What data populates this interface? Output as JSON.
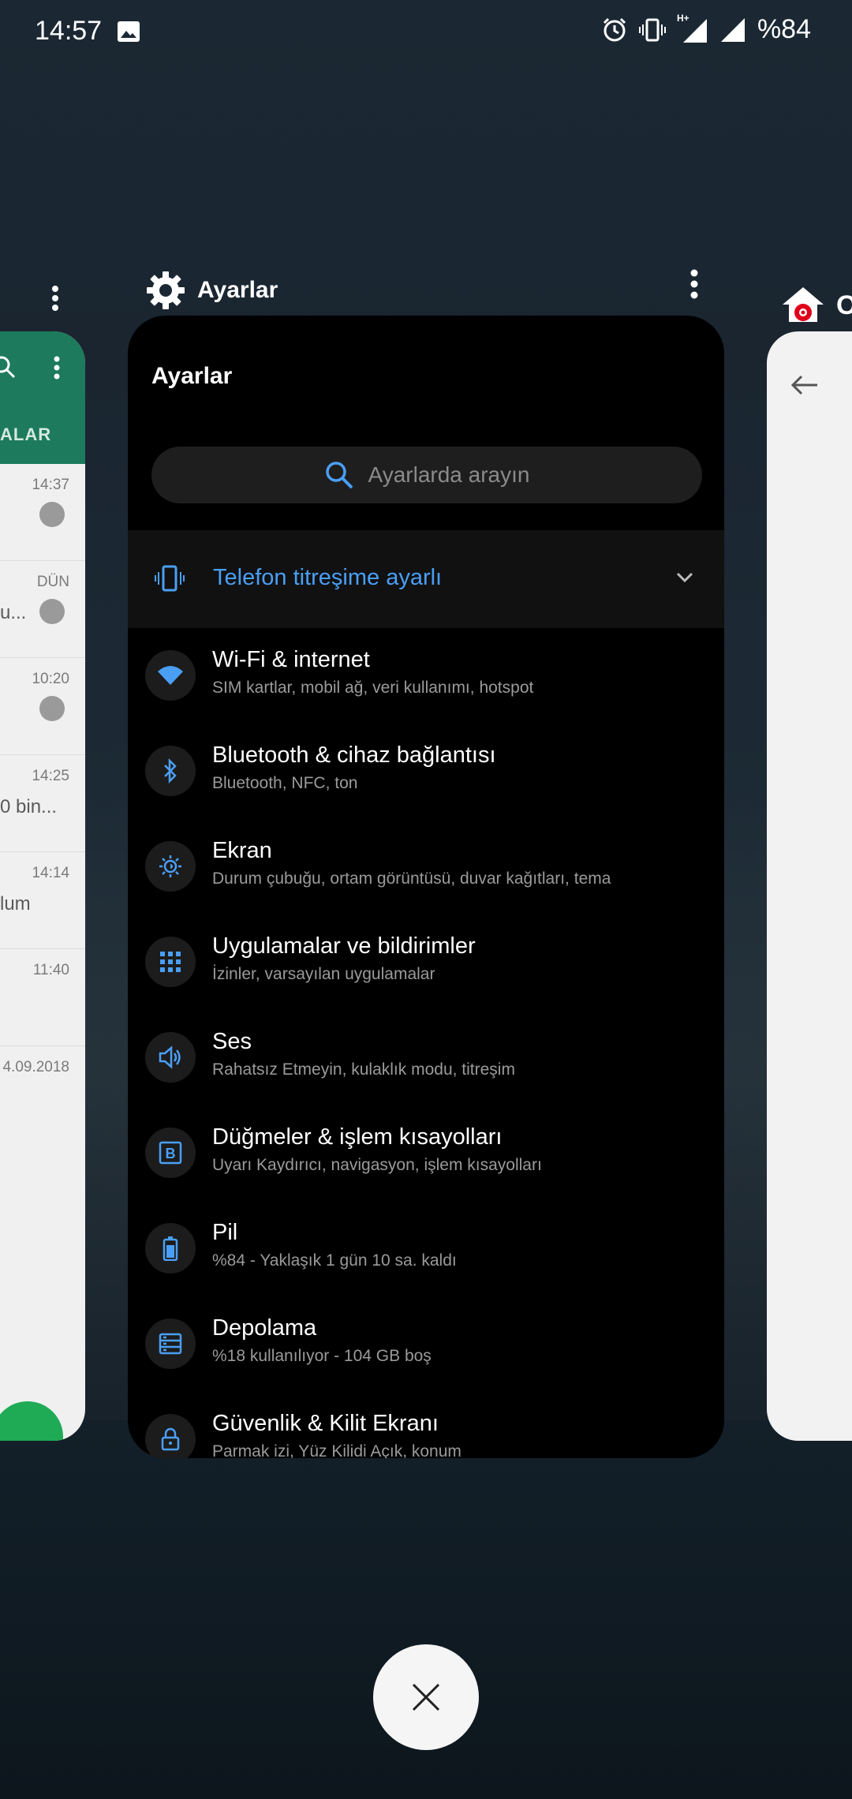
{
  "status_bar": {
    "time": "14:57",
    "network": "H+",
    "battery": "%84"
  },
  "left_card": {
    "tab": "ALAR",
    "rows": [
      {
        "time": "14:37",
        "snippet": ""
      },
      {
        "time": "DÜN",
        "snippet": "u..."
      },
      {
        "time": "10:20",
        "snippet": ""
      },
      {
        "time": "14:25",
        "snippet": "0 bin..."
      },
      {
        "time": "14:14",
        "snippet": "lum"
      },
      {
        "time": "11:40",
        "snippet": ""
      },
      {
        "time": "4.09.2018",
        "snippet": ""
      }
    ]
  },
  "right_card": {
    "letter": "O"
  },
  "app": {
    "name": "Ayarlar",
    "header_title": "Ayarlar",
    "search_placeholder": "Ayarlarda arayın",
    "suggestion": "Telefon titreşime ayarlı",
    "accent": "#4a9ff5",
    "items": [
      {
        "icon": "wifi-icon",
        "title": "Wi-Fi & internet",
        "subtitle": "SIM kartlar, mobil ağ, veri kullanımı, hotspot"
      },
      {
        "icon": "bluetooth-icon",
        "title": "Bluetooth & cihaz bağlantısı",
        "subtitle": "Bluetooth, NFC, ton"
      },
      {
        "icon": "brightness-icon",
        "title": "Ekran",
        "subtitle": "Durum çubuğu, ortam görüntüsü, duvar kağıtları, tema"
      },
      {
        "icon": "apps-grid-icon",
        "title": "Uygulamalar ve bildirimler",
        "subtitle": "İzinler, varsayılan uygulamalar"
      },
      {
        "icon": "volume-icon",
        "title": "Ses",
        "subtitle": "Rahatsız Etmeyin, kulaklık modu, titreşim"
      },
      {
        "icon": "buttons-icon",
        "title": "Düğmeler & işlem kısayolları",
        "subtitle": "Uyarı Kaydırıcı, navigasyon, işlem kısayolları"
      },
      {
        "icon": "battery-icon",
        "title": "Pil",
        "subtitle": "%84 - Yaklaşık 1 gün 10 sa. kaldı"
      },
      {
        "icon": "storage-icon",
        "title": "Depolama",
        "subtitle": "%18 kullanılıyor - 104 GB boş"
      },
      {
        "icon": "lock-icon",
        "title": "Güvenlik & Kilit Ekranı",
        "subtitle": "Parmak izi, Yüz Kilidi Açık, konum"
      }
    ]
  }
}
